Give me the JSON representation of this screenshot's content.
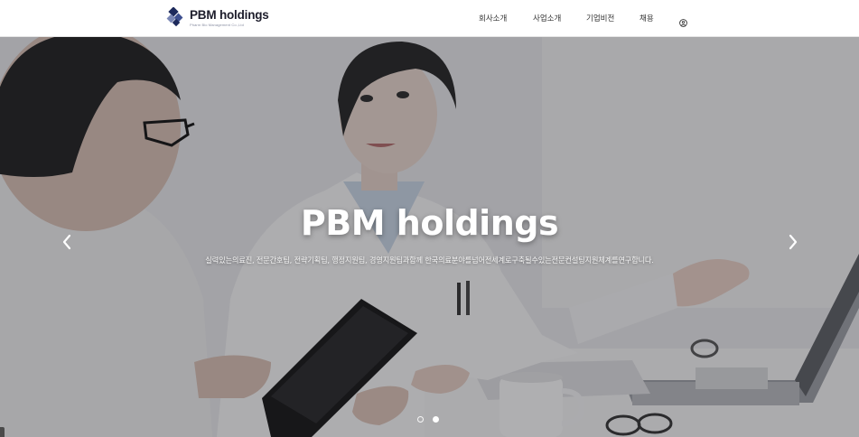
{
  "brand": {
    "name": "PBM holdings",
    "tagline": "Pharm Bio Management Co.,Ltd"
  },
  "nav": {
    "items": [
      {
        "label": "회사소개"
      },
      {
        "label": "사업소개"
      },
      {
        "label": "기업비전"
      },
      {
        "label": "채용"
      }
    ],
    "user_icon": "user-circle-icon"
  },
  "hero": {
    "title": "PBM holdings",
    "subtitle": "실력있는의료진, 전문간호팀, 전략기획팀, 행정지원팀, 경영지원팀과함께 한국의료분야를넘어전세계로구축될수있는전문컨설팅지원체계를연구합니다.",
    "prev_icon": "chevron-left-icon",
    "next_icon": "chevron-right-icon",
    "slides_total": 2,
    "active_slide": 2
  },
  "colors": {
    "header_bg": "#ffffff",
    "logo_navy": "#1d2a5c",
    "hero_text": "#ffffff"
  }
}
